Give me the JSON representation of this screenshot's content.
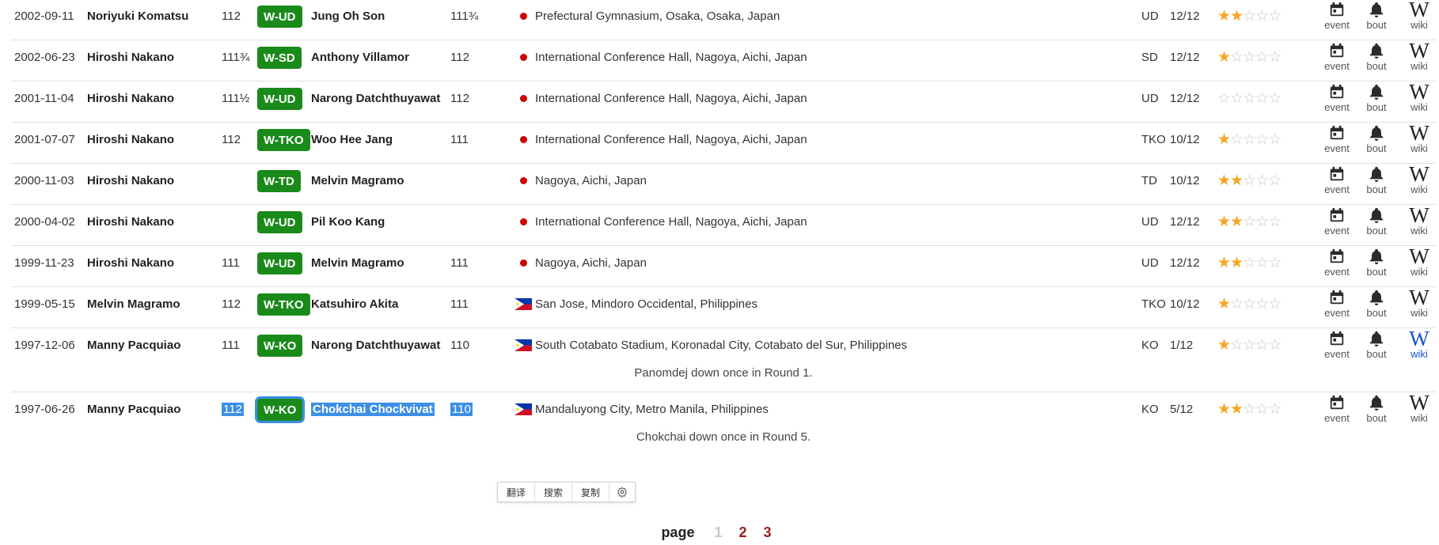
{
  "rows": [
    {
      "date": "2002-09-11",
      "fighter": "Noriyuki Komatsu",
      "w1": "112",
      "result": "W-UD",
      "opponent": "Jung Oh Son",
      "w2": "111¾",
      "flag": "dot",
      "venue": "Prefectural Gymnasium, Osaka, Osaka, Japan",
      "method": "UD",
      "rounds": "12/12",
      "stars": 2,
      "note": ""
    },
    {
      "date": "2002-06-23",
      "fighter": "Hiroshi Nakano",
      "w1": "111¾",
      "result": "W-SD",
      "opponent": "Anthony Villamor",
      "w2": "112",
      "flag": "dot",
      "venue": "International Conference Hall, Nagoya, Aichi, Japan",
      "method": "SD",
      "rounds": "12/12",
      "stars": 1,
      "note": ""
    },
    {
      "date": "2001-11-04",
      "fighter": "Hiroshi Nakano",
      "w1": "111½",
      "result": "W-UD",
      "opponent": "Narong Datchthuyawat",
      "w2": "112",
      "flag": "dot",
      "venue": "International Conference Hall, Nagoya, Aichi, Japan",
      "method": "UD",
      "rounds": "12/12",
      "stars": 0,
      "note": ""
    },
    {
      "date": "2001-07-07",
      "fighter": "Hiroshi Nakano",
      "w1": "112",
      "result": "W-TKO",
      "opponent": "Woo Hee Jang",
      "w2": "111",
      "flag": "dot",
      "venue": "International Conference Hall, Nagoya, Aichi, Japan",
      "method": "TKO",
      "rounds": "10/12",
      "stars": 1,
      "note": ""
    },
    {
      "date": "2000-11-03",
      "fighter": "Hiroshi Nakano",
      "w1": "",
      "result": "W-TD",
      "opponent": "Melvin Magramo",
      "w2": "",
      "flag": "dot",
      "venue": "Nagoya, Aichi, Japan",
      "method": "TD",
      "rounds": "10/12",
      "stars": 2,
      "note": ""
    },
    {
      "date": "2000-04-02",
      "fighter": "Hiroshi Nakano",
      "w1": "",
      "result": "W-UD",
      "opponent": "Pil Koo Kang",
      "w2": "",
      "flag": "dot",
      "venue": "International Conference Hall, Nagoya, Aichi, Japan",
      "method": "UD",
      "rounds": "12/12",
      "stars": 2,
      "note": ""
    },
    {
      "date": "1999-11-23",
      "fighter": "Hiroshi Nakano",
      "w1": "111",
      "result": "W-UD",
      "opponent": "Melvin Magramo",
      "w2": "111",
      "flag": "dot",
      "venue": "Nagoya, Aichi, Japan",
      "method": "UD",
      "rounds": "12/12",
      "stars": 2,
      "note": ""
    },
    {
      "date": "1999-05-15",
      "fighter": "Melvin Magramo",
      "w1": "112",
      "result": "W-TKO",
      "opponent": "Katsuhiro Akita",
      "w2": "111",
      "flag": "ph",
      "venue": "San Jose, Mindoro Occidental, Philippines",
      "method": "TKO",
      "rounds": "10/12",
      "stars": 1,
      "note": ""
    },
    {
      "date": "1997-12-06",
      "fighter": "Manny Pacquiao",
      "w1": "111",
      "result": "W-KO",
      "opponent": "Narong Datchthuyawat",
      "w2": "110",
      "flag": "ph",
      "venue": "South Cotabato Stadium, Koronadal City, Cotabato del Sur, Philippines",
      "method": "KO",
      "rounds": "1/12",
      "stars": 1,
      "note": "Panomdej down once in Round 1.",
      "wiki_visited": true
    },
    {
      "date": "1997-06-26",
      "fighter": "Manny Pacquiao",
      "w1": "112",
      "result": "W-KO",
      "opponent": "Chokchai Chockvivat",
      "w2": "110",
      "flag": "ph",
      "venue": "Mandaluyong City, Metro Manila, Philippines",
      "method": "KO",
      "rounds": "5/12",
      "stars": 2,
      "note": "Chokchai down once in Round 5.",
      "selected": true
    }
  ],
  "icons": {
    "event_label": "event",
    "bout_label": "bout",
    "wiki_label": "wiki",
    "wiki_glyph": "W"
  },
  "popup": {
    "translate": "翻译",
    "search": "搜索",
    "copy": "复制"
  },
  "pager": {
    "label": "page",
    "pages": [
      "1",
      "2",
      "3"
    ],
    "current": "1"
  },
  "colors": {
    "win_badge": "#1a8a1a",
    "star": "#f5a623",
    "selection": "#3d8fe6",
    "page_link": "#9b1c1c"
  }
}
